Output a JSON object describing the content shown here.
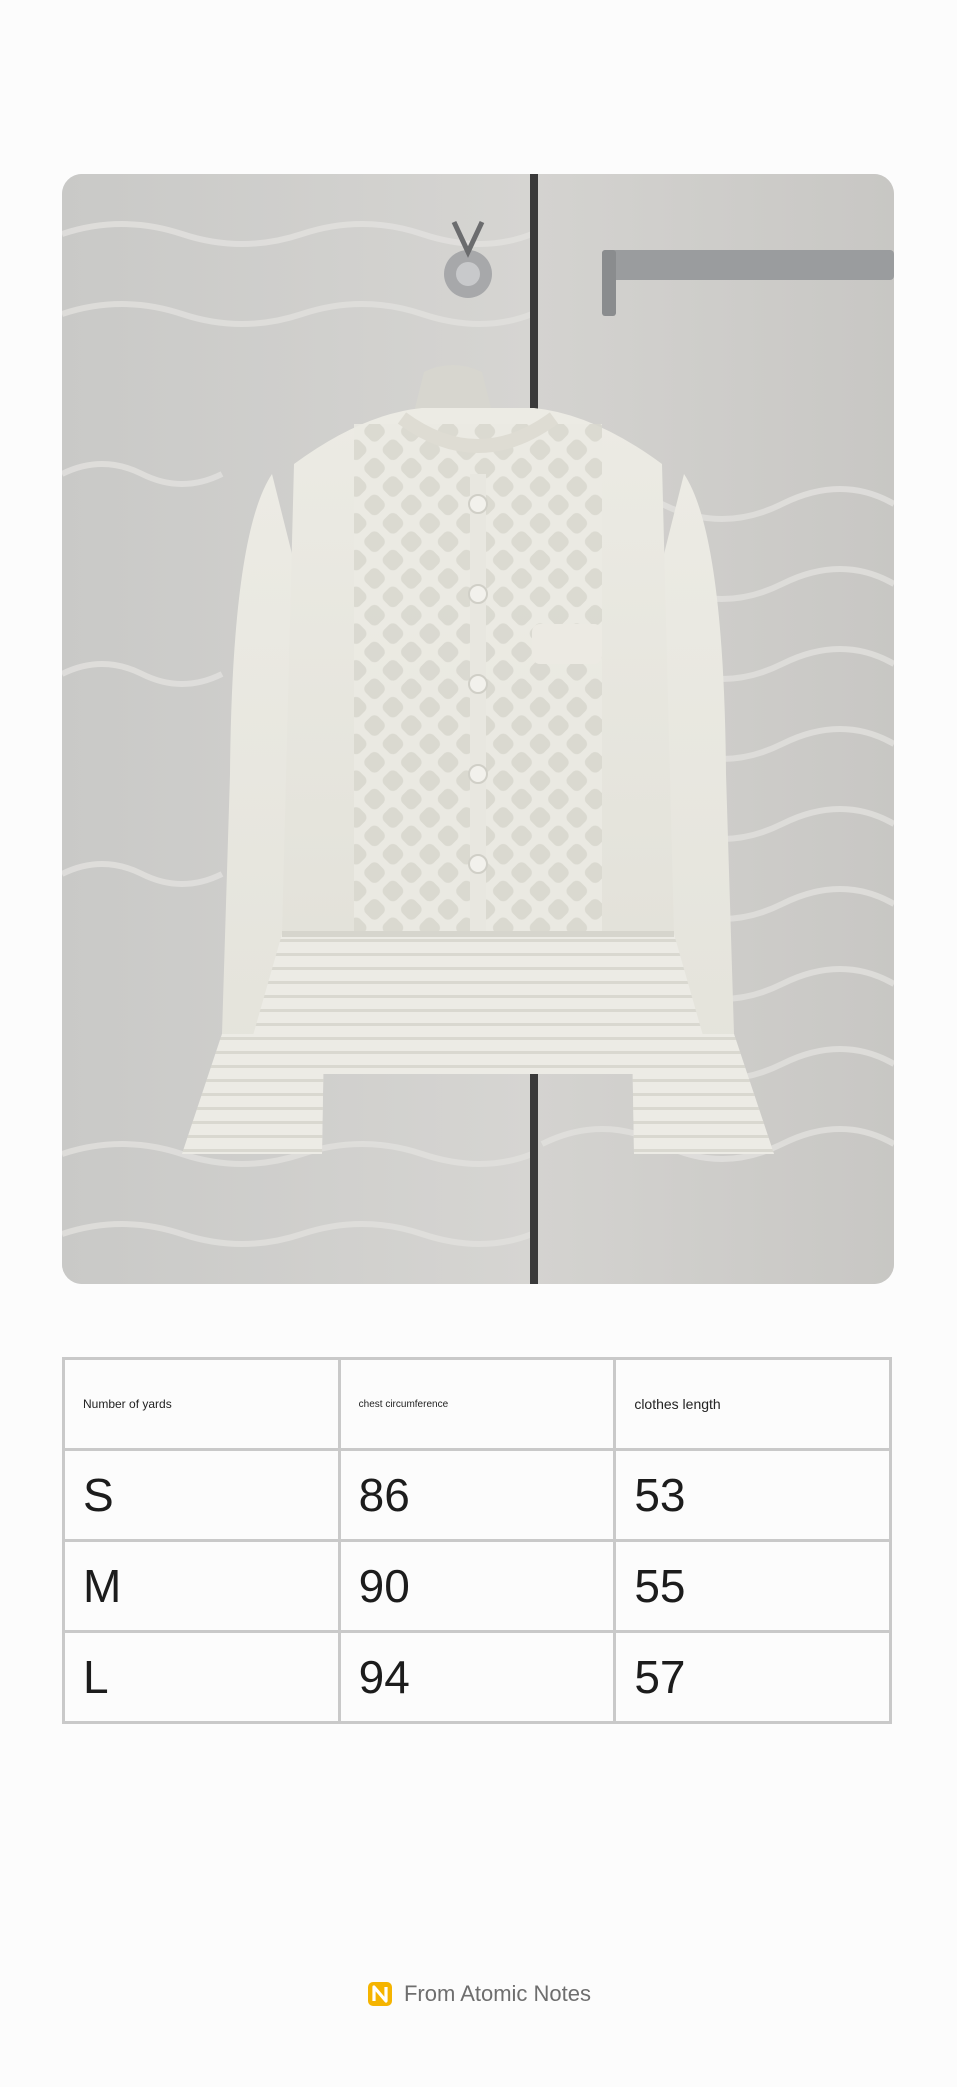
{
  "product_image": {
    "alt": "cream-knit-cardigan-photo"
  },
  "size_table": {
    "headers": [
      "Number of yards",
      "chest circumference",
      "clothes length"
    ],
    "rows": [
      [
        "S",
        "86",
        "53"
      ],
      [
        "M",
        "90",
        "55"
      ],
      [
        "L",
        "94",
        "57"
      ]
    ]
  },
  "footer": {
    "icon": "atomic-notes-logo-icon",
    "text": "From Atomic Notes",
    "accent_color": "#f5b400"
  }
}
